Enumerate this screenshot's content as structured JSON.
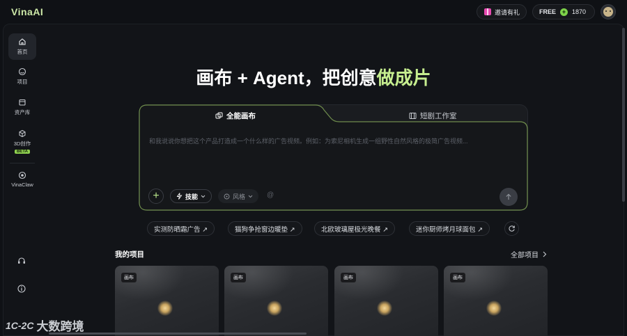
{
  "app": {
    "logo": "VinaAI"
  },
  "header": {
    "invite_label": "邀请有礼",
    "plan_label": "FREE",
    "credits": "1870"
  },
  "sidebar": {
    "items": [
      {
        "label": "首页",
        "icon": "home-icon",
        "active": true
      },
      {
        "label": "项目",
        "icon": "project-icon",
        "active": false
      },
      {
        "label": "资产库",
        "icon": "asset-library-icon",
        "active": false
      },
      {
        "label": "3D创作",
        "icon": "cube-icon",
        "active": false,
        "badge": "BETA"
      },
      {
        "label": "VinaClaw",
        "icon": "vinaclaw-icon",
        "active": false
      }
    ],
    "bottom_icons": [
      "headset-icon",
      "info-icon"
    ]
  },
  "hero": {
    "title_main": "画布 + Agent，把创意",
    "title_highlight": "做成片"
  },
  "composer": {
    "tabs": [
      {
        "label": "全能画布",
        "icon": "canvas-icon",
        "active": true
      },
      {
        "label": "短剧工作室",
        "icon": "film-icon",
        "active": false
      }
    ],
    "placeholder": "和我说说你想把这个产品打造成一个什么样的广告视频。例如：为索尼相机生成一组野性自然风格的极简广告视频...",
    "skill_label": "技能",
    "style_label": "风格",
    "at_symbol": "@"
  },
  "suggestions": [
    "实测防晒霜广告 ↗",
    "猫狗争抢窗边暖垫 ↗",
    "北欧玻璃屋极光晚餐 ↗",
    "迷你厨师烤月球面包 ↗"
  ],
  "projects": {
    "title": "我的项目",
    "all_label": "全部项目",
    "cards": [
      {
        "tag": "画布"
      },
      {
        "tag": "画布"
      },
      {
        "tag": "画布"
      },
      {
        "tag": "画布"
      }
    ]
  },
  "watermark": {
    "logo_text": "1C-2C",
    "text": "大数跨境"
  },
  "colors": {
    "accent": "#c6ee8f",
    "background": "#0f1115",
    "beta_badge": "#8fd14f",
    "coin": "#7ed34a"
  }
}
